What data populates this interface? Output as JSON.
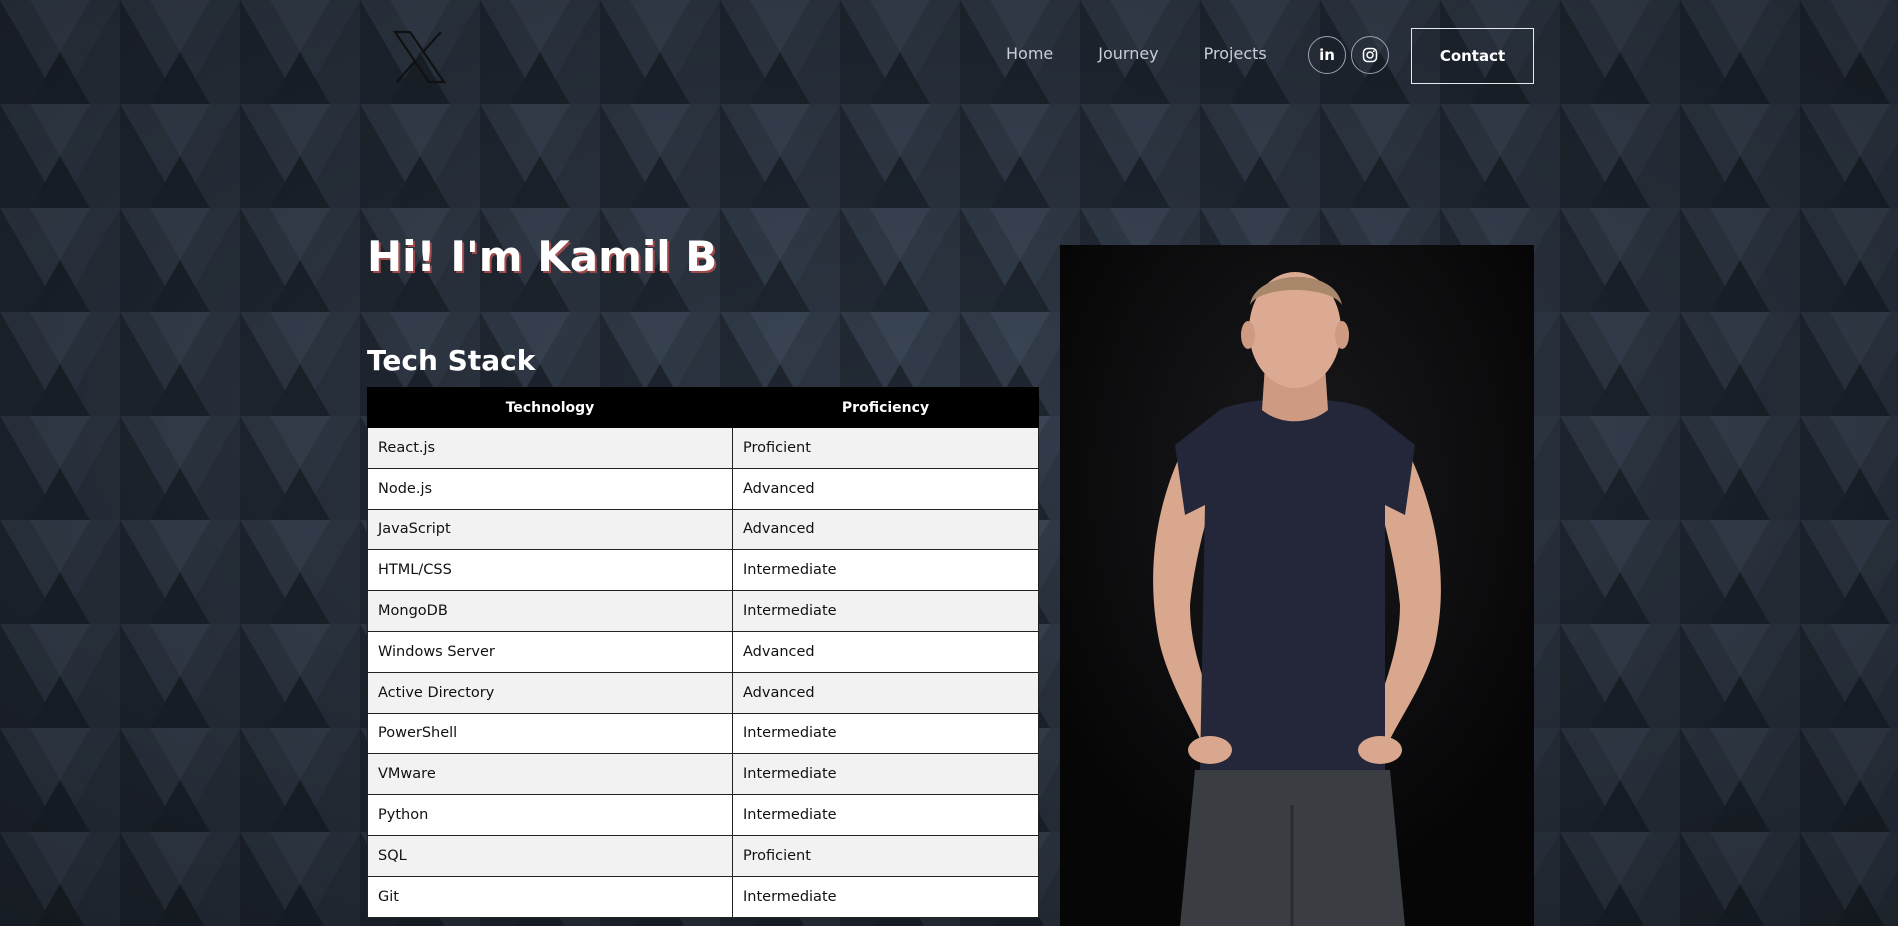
{
  "header": {
    "logo_icon": "x-logo-icon",
    "nav": [
      {
        "label": "Home"
      },
      {
        "label": "Journey"
      },
      {
        "label": "Projects"
      }
    ],
    "social": [
      {
        "icon": "linkedin-icon",
        "label": "in"
      },
      {
        "icon": "instagram-icon"
      }
    ],
    "contact_label": "Contact"
  },
  "hero": {
    "title": "Hi! I'm Kamil B"
  },
  "tech_stack": {
    "title": "Tech Stack",
    "columns": [
      "Technology",
      "Proficiency"
    ],
    "rows": [
      [
        "React.js",
        "Proficient"
      ],
      [
        "Node.js",
        "Advanced"
      ],
      [
        "JavaScript",
        "Advanced"
      ],
      [
        "HTML/CSS",
        "Intermediate"
      ],
      [
        "MongoDB",
        "Intermediate"
      ],
      [
        "Windows Server",
        "Advanced"
      ],
      [
        "Active Directory",
        "Advanced"
      ],
      [
        "PowerShell",
        "Intermediate"
      ],
      [
        "VMware",
        "Intermediate"
      ],
      [
        "Python",
        "Intermediate"
      ],
      [
        "SQL",
        "Proficient"
      ],
      [
        "Git",
        "Intermediate"
      ]
    ]
  },
  "colors": {
    "background": "#2a3340",
    "table_header": "#000000",
    "row_alt": "#f2f2f2"
  }
}
